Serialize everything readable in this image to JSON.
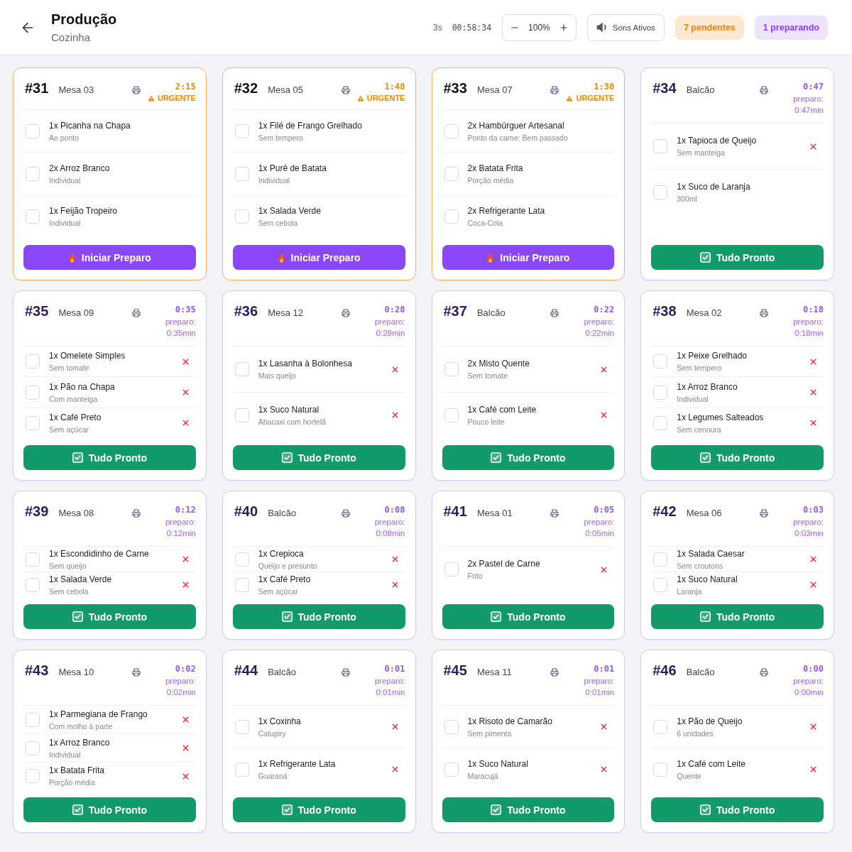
{
  "header": {
    "title": "Produção",
    "subtitle": "Cozinha",
    "refresh_interval": "3s",
    "clock": "00:58:34",
    "zoom": "100%",
    "sound_button": "Sons Ativos",
    "badges": [
      {
        "kind": "pending",
        "label": "7 pendentes"
      },
      {
        "kind": "preparing",
        "label": "1 preparando"
      }
    ]
  },
  "orders": [
    {
      "number": "#31",
      "table": "Mesa 03",
      "timer": "2:15",
      "status": {
        "kind": "urgent",
        "label": "URGENTE"
      },
      "items": [
        {
          "name": "1x Picanha na Chapa",
          "note": "Ao ponto",
          "checked": false,
          "cancel_button": false
        },
        {
          "name": "2x Arroz Branco",
          "note": "Individual",
          "checked": false,
          "cancel_button": false
        },
        {
          "name": "1x Feijão Tropeiro",
          "note": "Individual",
          "checked": false,
          "cancel_button": false
        }
      ],
      "action": {
        "kind": "start",
        "label": "Iniciar Preparo"
      }
    },
    {
      "number": "#32",
      "table": "Mesa 05",
      "timer": "1:48",
      "status": {
        "kind": "urgent",
        "label": "URGENTE"
      },
      "items": [
        {
          "name": "1x Filé de Frango Grelhado",
          "note": "Sem tempero",
          "checked": false,
          "cancel_button": false
        },
        {
          "name": "1x Purê de Batata",
          "note": "Individual",
          "checked": false,
          "cancel_button": false
        },
        {
          "name": "1x Salada Verde",
          "note": "Sem cebola",
          "checked": false,
          "cancel_button": false
        }
      ],
      "action": {
        "kind": "start",
        "label": "Iniciar Preparo"
      }
    },
    {
      "number": "#33",
      "table": "Mesa 07",
      "timer": "1:30",
      "status": {
        "kind": "urgent",
        "label": "URGENTE"
      },
      "items": [
        {
          "name": "2x Hambúrguer Artesanal",
          "note": "Ponto da carne: Bem passado",
          "checked": false,
          "cancel_button": false
        },
        {
          "name": "2x Batata Frita",
          "note": "Porção média",
          "checked": false,
          "cancel_button": false
        },
        {
          "name": "2x Refrigerante Lata",
          "note": "Coca-Cola",
          "checked": false,
          "cancel_button": false
        }
      ],
      "action": {
        "kind": "start",
        "label": "Iniciar Preparo"
      }
    },
    {
      "number": "#34",
      "table": "Balcão",
      "timer": "0:47",
      "status": {
        "kind": "preparing",
        "label": "preparo: 0:47min"
      },
      "items": [
        {
          "name": "1x Tapioca de Queijo",
          "note": "Sem manteiga",
          "checked": false,
          "cancel_button": true
        },
        {
          "name": "1x Suco de Laranja",
          "note": "300ml",
          "checked": false,
          "cancel_button": false
        }
      ],
      "action": {
        "kind": "done",
        "label": "Tudo Pronto"
      }
    },
    {
      "number": "#35",
      "table": "Mesa 09",
      "timer": "0:35",
      "status": {
        "kind": "preparing",
        "label": "preparo: 0:35min"
      },
      "items": [
        {
          "name": "1x Omelete Simples",
          "note": "Sem tomate",
          "checked": false,
          "cancel_button": true
        },
        {
          "name": "1x Pão na Chapa",
          "note": "Com manteiga",
          "checked": false,
          "cancel_button": true
        },
        {
          "name": "1x Café Preto",
          "note": "Sem açúcar",
          "checked": false,
          "cancel_button": true
        }
      ],
      "action": {
        "kind": "done",
        "label": "Tudo Pronto"
      }
    },
    {
      "number": "#36",
      "table": "Mesa 12",
      "timer": "0:28",
      "status": {
        "kind": "preparing",
        "label": "preparo: 0:28min"
      },
      "items": [
        {
          "name": "1x Lasanha à Bolonhesa",
          "note": "Mais queijo",
          "checked": false,
          "cancel_button": true
        },
        {
          "name": "1x Suco Natural",
          "note": "Abacaxi com hortelã",
          "checked": false,
          "cancel_button": true
        }
      ],
      "action": {
        "kind": "done",
        "label": "Tudo Pronto"
      }
    },
    {
      "number": "#37",
      "table": "Balcão",
      "timer": "0:22",
      "status": {
        "kind": "preparing",
        "label": "preparo: 0:22min"
      },
      "items": [
        {
          "name": "2x Misto Quente",
          "note": "Sem tomate",
          "checked": false,
          "cancel_button": true
        },
        {
          "name": "1x Café com Leite",
          "note": "Pouco leite",
          "checked": false,
          "cancel_button": true
        }
      ],
      "action": {
        "kind": "done",
        "label": "Tudo Pronto"
      }
    },
    {
      "number": "#38",
      "table": "Mesa 02",
      "timer": "0:18",
      "status": {
        "kind": "preparing",
        "label": "preparo: 0:18min"
      },
      "items": [
        {
          "name": "1x Peixe Grelhado",
          "note": "Sem tempero",
          "checked": false,
          "cancel_button": true
        },
        {
          "name": "1x Arroz Branco",
          "note": "Individual",
          "checked": false,
          "cancel_button": true
        },
        {
          "name": "1x Legumes Salteados",
          "note": "Sem cenoura",
          "checked": false,
          "cancel_button": true
        }
      ],
      "action": {
        "kind": "done",
        "label": "Tudo Pronto"
      }
    },
    {
      "number": "#39",
      "table": "Mesa 08",
      "timer": "0:12",
      "status": {
        "kind": "preparing",
        "label": "preparo: 0:12min"
      },
      "items": [
        {
          "name": "1x Escondidinho de Carne",
          "note": "Sem queijo",
          "checked": false,
          "cancel_button": true
        },
        {
          "name": "1x Salada Verde",
          "note": "Sem cebola",
          "checked": false,
          "cancel_button": true
        }
      ],
      "action": {
        "kind": "done",
        "label": "Tudo Pronto"
      }
    },
    {
      "number": "#40",
      "table": "Balcão",
      "timer": "0:08",
      "status": {
        "kind": "preparing",
        "label": "preparo: 0:08min"
      },
      "items": [
        {
          "name": "1x Crepioca",
          "note": "Queijo e presunto",
          "checked": false,
          "cancel_button": true
        },
        {
          "name": "1x Café Preto",
          "note": "Sem açúcar",
          "checked": false,
          "cancel_button": true
        }
      ],
      "action": {
        "kind": "done",
        "label": "Tudo Pronto"
      }
    },
    {
      "number": "#41",
      "table": "Mesa 01",
      "timer": "0:05",
      "status": {
        "kind": "preparing",
        "label": "preparo: 0:05min"
      },
      "items": [
        {
          "name": "2x Pastel de Carne",
          "note": "Frito",
          "checked": false,
          "cancel_button": true
        }
      ],
      "action": {
        "kind": "done",
        "label": "Tudo Pronto"
      }
    },
    {
      "number": "#42",
      "table": "Mesa 06",
      "timer": "0:03",
      "status": {
        "kind": "preparing",
        "label": "preparo: 0:03min"
      },
      "items": [
        {
          "name": "1x Salada Caesar",
          "note": "Sem croutons",
          "checked": false,
          "cancel_button": true
        },
        {
          "name": "1x Suco Natural",
          "note": "Laranja",
          "checked": false,
          "cancel_button": true
        }
      ],
      "action": {
        "kind": "done",
        "label": "Tudo Pronto"
      }
    },
    {
      "number": "#43",
      "table": "Mesa 10",
      "timer": "0:02",
      "status": {
        "kind": "preparing",
        "label": "preparo: 0:02min"
      },
      "items": [
        {
          "name": "1x Parmegiana de Frango",
          "note": "Com molho à parte",
          "checked": false,
          "cancel_button": true
        },
        {
          "name": "1x Arroz Branco",
          "note": "Individual",
          "checked": false,
          "cancel_button": true
        },
        {
          "name": "1x Batata Frita",
          "note": "Porção média",
          "checked": false,
          "cancel_button": true
        }
      ],
      "action": {
        "kind": "done",
        "label": "Tudo Pronto"
      }
    },
    {
      "number": "#44",
      "table": "Balcão",
      "timer": "0:01",
      "status": {
        "kind": "preparing",
        "label": "preparo: 0:01min"
      },
      "items": [
        {
          "name": "1x Coxinha",
          "note": "Catupiry",
          "checked": false,
          "cancel_button": true
        },
        {
          "name": "1x Refrigerante Lata",
          "note": "Guaraná",
          "checked": false,
          "cancel_button": true
        }
      ],
      "action": {
        "kind": "done",
        "label": "Tudo Pronto"
      }
    },
    {
      "number": "#45",
      "table": "Mesa 11",
      "timer": "0:01",
      "status": {
        "kind": "preparing",
        "label": "preparo: 0:01min"
      },
      "items": [
        {
          "name": "1x Risoto de Camarão",
          "note": "Sem pimenta",
          "checked": false,
          "cancel_button": true
        },
        {
          "name": "1x Suco Natural",
          "note": "Maracujá",
          "checked": false,
          "cancel_button": true
        }
      ],
      "action": {
        "kind": "done",
        "label": "Tudo Pronto"
      }
    },
    {
      "number": "#46",
      "table": "Balcão",
      "timer": "0:00",
      "status": {
        "kind": "preparing",
        "label": "preparo: 0:00min"
      },
      "items": [
        {
          "name": "1x Pão de Queijo",
          "note": "6 unidades",
          "checked": false,
          "cancel_button": true
        },
        {
          "name": "1x Café com Leite",
          "note": "Quente",
          "checked": false,
          "cancel_button": true
        }
      ],
      "action": {
        "kind": "done",
        "label": "Tudo Pronto"
      }
    }
  ]
}
